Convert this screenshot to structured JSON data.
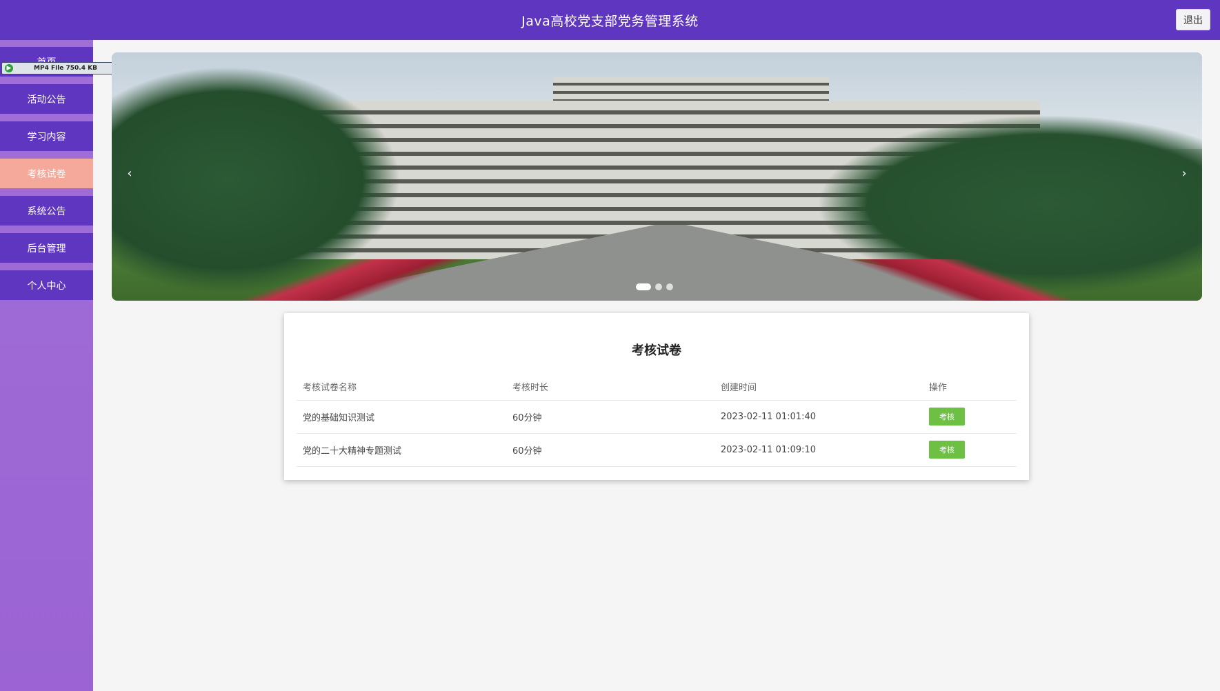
{
  "header": {
    "title": "Java高校党支部党务管理系统",
    "logout_label": "退出"
  },
  "sidebar": {
    "items": [
      {
        "label": "首页"
      },
      {
        "label": "活动公告"
      },
      {
        "label": "学习内容"
      },
      {
        "label": "考核试卷"
      },
      {
        "label": "系统公告"
      },
      {
        "label": "后台管理"
      },
      {
        "label": "个人中心"
      }
    ]
  },
  "overlay": {
    "label": "MP4 File 750.4 KB"
  },
  "carousel": {
    "prev": "‹",
    "next": "›"
  },
  "exam_list": {
    "title": "考核试卷",
    "columns": [
      "考核试卷名称",
      "考核时长",
      "创建时间",
      "操作"
    ],
    "rows": [
      {
        "name": "党的基础知识测试",
        "duration": "60分钟",
        "created": "2023-02-11 01:01:40",
        "action": "考核"
      },
      {
        "name": "党的二十大精神专题测试",
        "duration": "60分钟",
        "created": "2023-02-11 01:09:10",
        "action": "考核"
      }
    ]
  },
  "colors": {
    "primary": "#5f36bf",
    "active_nav": "#f4a99a",
    "sidebar_bg": "#a06fd6",
    "action_button": "#6ec044"
  },
  "icons": {
    "prev": "chevron-left-icon",
    "next": "chevron-right-icon"
  }
}
